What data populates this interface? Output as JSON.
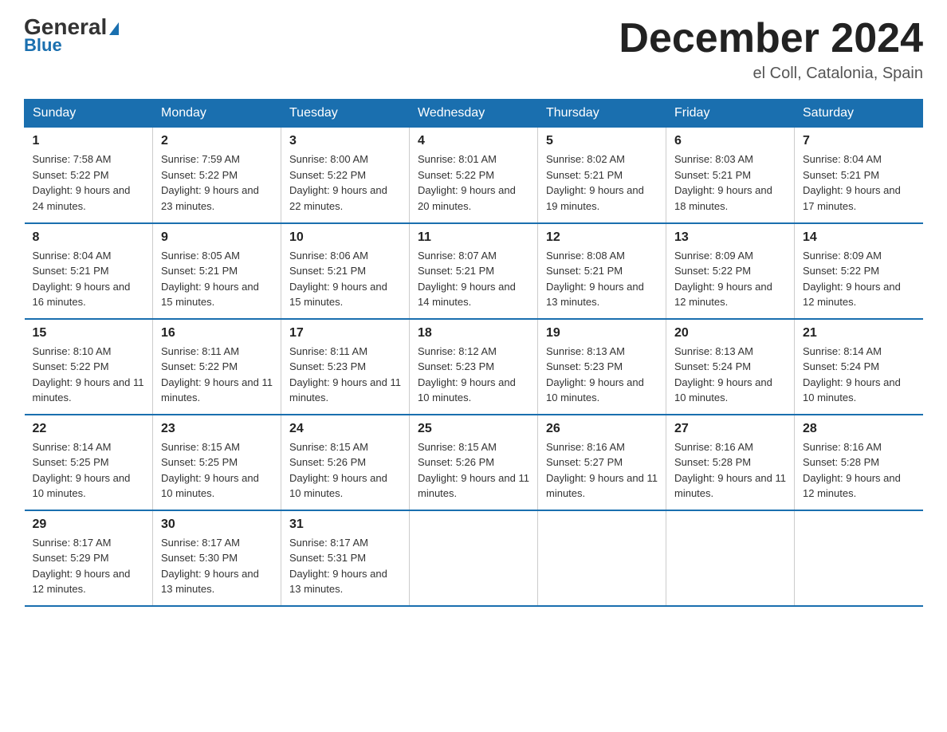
{
  "header": {
    "logo_general": "General",
    "logo_blue": "Blue",
    "title": "December 2024",
    "location": "el Coll, Catalonia, Spain"
  },
  "weekdays": [
    "Sunday",
    "Monday",
    "Tuesday",
    "Wednesday",
    "Thursday",
    "Friday",
    "Saturday"
  ],
  "weeks": [
    [
      {
        "day": "1",
        "sunrise": "7:58 AM",
        "sunset": "5:22 PM",
        "daylight": "9 hours and 24 minutes."
      },
      {
        "day": "2",
        "sunrise": "7:59 AM",
        "sunset": "5:22 PM",
        "daylight": "9 hours and 23 minutes."
      },
      {
        "day": "3",
        "sunrise": "8:00 AM",
        "sunset": "5:22 PM",
        "daylight": "9 hours and 22 minutes."
      },
      {
        "day": "4",
        "sunrise": "8:01 AM",
        "sunset": "5:22 PM",
        "daylight": "9 hours and 20 minutes."
      },
      {
        "day": "5",
        "sunrise": "8:02 AM",
        "sunset": "5:21 PM",
        "daylight": "9 hours and 19 minutes."
      },
      {
        "day": "6",
        "sunrise": "8:03 AM",
        "sunset": "5:21 PM",
        "daylight": "9 hours and 18 minutes."
      },
      {
        "day": "7",
        "sunrise": "8:04 AM",
        "sunset": "5:21 PM",
        "daylight": "9 hours and 17 minutes."
      }
    ],
    [
      {
        "day": "8",
        "sunrise": "8:04 AM",
        "sunset": "5:21 PM",
        "daylight": "9 hours and 16 minutes."
      },
      {
        "day": "9",
        "sunrise": "8:05 AM",
        "sunset": "5:21 PM",
        "daylight": "9 hours and 15 minutes."
      },
      {
        "day": "10",
        "sunrise": "8:06 AM",
        "sunset": "5:21 PM",
        "daylight": "9 hours and 15 minutes."
      },
      {
        "day": "11",
        "sunrise": "8:07 AM",
        "sunset": "5:21 PM",
        "daylight": "9 hours and 14 minutes."
      },
      {
        "day": "12",
        "sunrise": "8:08 AM",
        "sunset": "5:21 PM",
        "daylight": "9 hours and 13 minutes."
      },
      {
        "day": "13",
        "sunrise": "8:09 AM",
        "sunset": "5:22 PM",
        "daylight": "9 hours and 12 minutes."
      },
      {
        "day": "14",
        "sunrise": "8:09 AM",
        "sunset": "5:22 PM",
        "daylight": "9 hours and 12 minutes."
      }
    ],
    [
      {
        "day": "15",
        "sunrise": "8:10 AM",
        "sunset": "5:22 PM",
        "daylight": "9 hours and 11 minutes."
      },
      {
        "day": "16",
        "sunrise": "8:11 AM",
        "sunset": "5:22 PM",
        "daylight": "9 hours and 11 minutes."
      },
      {
        "day": "17",
        "sunrise": "8:11 AM",
        "sunset": "5:23 PM",
        "daylight": "9 hours and 11 minutes."
      },
      {
        "day": "18",
        "sunrise": "8:12 AM",
        "sunset": "5:23 PM",
        "daylight": "9 hours and 10 minutes."
      },
      {
        "day": "19",
        "sunrise": "8:13 AM",
        "sunset": "5:23 PM",
        "daylight": "9 hours and 10 minutes."
      },
      {
        "day": "20",
        "sunrise": "8:13 AM",
        "sunset": "5:24 PM",
        "daylight": "9 hours and 10 minutes."
      },
      {
        "day": "21",
        "sunrise": "8:14 AM",
        "sunset": "5:24 PM",
        "daylight": "9 hours and 10 minutes."
      }
    ],
    [
      {
        "day": "22",
        "sunrise": "8:14 AM",
        "sunset": "5:25 PM",
        "daylight": "9 hours and 10 minutes."
      },
      {
        "day": "23",
        "sunrise": "8:15 AM",
        "sunset": "5:25 PM",
        "daylight": "9 hours and 10 minutes."
      },
      {
        "day": "24",
        "sunrise": "8:15 AM",
        "sunset": "5:26 PM",
        "daylight": "9 hours and 10 minutes."
      },
      {
        "day": "25",
        "sunrise": "8:15 AM",
        "sunset": "5:26 PM",
        "daylight": "9 hours and 11 minutes."
      },
      {
        "day": "26",
        "sunrise": "8:16 AM",
        "sunset": "5:27 PM",
        "daylight": "9 hours and 11 minutes."
      },
      {
        "day": "27",
        "sunrise": "8:16 AM",
        "sunset": "5:28 PM",
        "daylight": "9 hours and 11 minutes."
      },
      {
        "day": "28",
        "sunrise": "8:16 AM",
        "sunset": "5:28 PM",
        "daylight": "9 hours and 12 minutes."
      }
    ],
    [
      {
        "day": "29",
        "sunrise": "8:17 AM",
        "sunset": "5:29 PM",
        "daylight": "9 hours and 12 minutes."
      },
      {
        "day": "30",
        "sunrise": "8:17 AM",
        "sunset": "5:30 PM",
        "daylight": "9 hours and 13 minutes."
      },
      {
        "day": "31",
        "sunrise": "8:17 AM",
        "sunset": "5:31 PM",
        "daylight": "9 hours and 13 minutes."
      },
      null,
      null,
      null,
      null
    ]
  ]
}
